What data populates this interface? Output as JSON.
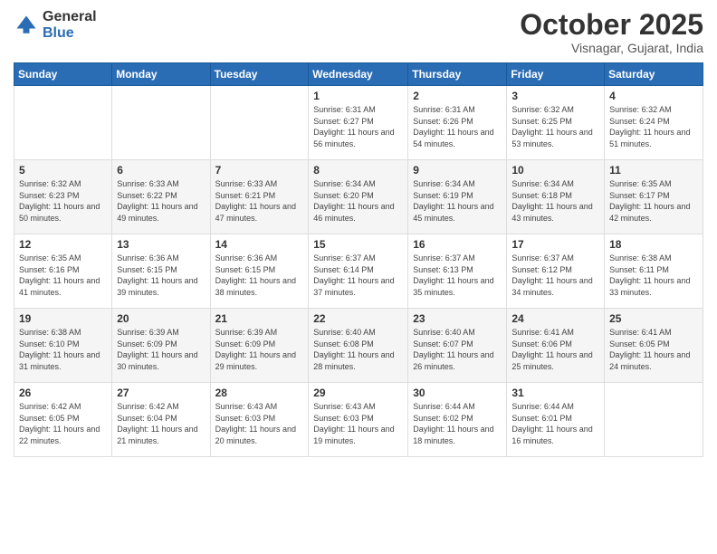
{
  "header": {
    "logo": {
      "general": "General",
      "blue": "Blue"
    },
    "title": "October 2025",
    "location": "Visnagar, Gujarat, India"
  },
  "weekdays": [
    "Sunday",
    "Monday",
    "Tuesday",
    "Wednesday",
    "Thursday",
    "Friday",
    "Saturday"
  ],
  "weeks": [
    [
      {
        "day": "",
        "sunrise": "",
        "sunset": "",
        "daylight": ""
      },
      {
        "day": "",
        "sunrise": "",
        "sunset": "",
        "daylight": ""
      },
      {
        "day": "",
        "sunrise": "",
        "sunset": "",
        "daylight": ""
      },
      {
        "day": "1",
        "sunrise": "Sunrise: 6:31 AM",
        "sunset": "Sunset: 6:27 PM",
        "daylight": "Daylight: 11 hours and 56 minutes."
      },
      {
        "day": "2",
        "sunrise": "Sunrise: 6:31 AM",
        "sunset": "Sunset: 6:26 PM",
        "daylight": "Daylight: 11 hours and 54 minutes."
      },
      {
        "day": "3",
        "sunrise": "Sunrise: 6:32 AM",
        "sunset": "Sunset: 6:25 PM",
        "daylight": "Daylight: 11 hours and 53 minutes."
      },
      {
        "day": "4",
        "sunrise": "Sunrise: 6:32 AM",
        "sunset": "Sunset: 6:24 PM",
        "daylight": "Daylight: 11 hours and 51 minutes."
      }
    ],
    [
      {
        "day": "5",
        "sunrise": "Sunrise: 6:32 AM",
        "sunset": "Sunset: 6:23 PM",
        "daylight": "Daylight: 11 hours and 50 minutes."
      },
      {
        "day": "6",
        "sunrise": "Sunrise: 6:33 AM",
        "sunset": "Sunset: 6:22 PM",
        "daylight": "Daylight: 11 hours and 49 minutes."
      },
      {
        "day": "7",
        "sunrise": "Sunrise: 6:33 AM",
        "sunset": "Sunset: 6:21 PM",
        "daylight": "Daylight: 11 hours and 47 minutes."
      },
      {
        "day": "8",
        "sunrise": "Sunrise: 6:34 AM",
        "sunset": "Sunset: 6:20 PM",
        "daylight": "Daylight: 11 hours and 46 minutes."
      },
      {
        "day": "9",
        "sunrise": "Sunrise: 6:34 AM",
        "sunset": "Sunset: 6:19 PM",
        "daylight": "Daylight: 11 hours and 45 minutes."
      },
      {
        "day": "10",
        "sunrise": "Sunrise: 6:34 AM",
        "sunset": "Sunset: 6:18 PM",
        "daylight": "Daylight: 11 hours and 43 minutes."
      },
      {
        "day": "11",
        "sunrise": "Sunrise: 6:35 AM",
        "sunset": "Sunset: 6:17 PM",
        "daylight": "Daylight: 11 hours and 42 minutes."
      }
    ],
    [
      {
        "day": "12",
        "sunrise": "Sunrise: 6:35 AM",
        "sunset": "Sunset: 6:16 PM",
        "daylight": "Daylight: 11 hours and 41 minutes."
      },
      {
        "day": "13",
        "sunrise": "Sunrise: 6:36 AM",
        "sunset": "Sunset: 6:15 PM",
        "daylight": "Daylight: 11 hours and 39 minutes."
      },
      {
        "day": "14",
        "sunrise": "Sunrise: 6:36 AM",
        "sunset": "Sunset: 6:15 PM",
        "daylight": "Daylight: 11 hours and 38 minutes."
      },
      {
        "day": "15",
        "sunrise": "Sunrise: 6:37 AM",
        "sunset": "Sunset: 6:14 PM",
        "daylight": "Daylight: 11 hours and 37 minutes."
      },
      {
        "day": "16",
        "sunrise": "Sunrise: 6:37 AM",
        "sunset": "Sunset: 6:13 PM",
        "daylight": "Daylight: 11 hours and 35 minutes."
      },
      {
        "day": "17",
        "sunrise": "Sunrise: 6:37 AM",
        "sunset": "Sunset: 6:12 PM",
        "daylight": "Daylight: 11 hours and 34 minutes."
      },
      {
        "day": "18",
        "sunrise": "Sunrise: 6:38 AM",
        "sunset": "Sunset: 6:11 PM",
        "daylight": "Daylight: 11 hours and 33 minutes."
      }
    ],
    [
      {
        "day": "19",
        "sunrise": "Sunrise: 6:38 AM",
        "sunset": "Sunset: 6:10 PM",
        "daylight": "Daylight: 11 hours and 31 minutes."
      },
      {
        "day": "20",
        "sunrise": "Sunrise: 6:39 AM",
        "sunset": "Sunset: 6:09 PM",
        "daylight": "Daylight: 11 hours and 30 minutes."
      },
      {
        "day": "21",
        "sunrise": "Sunrise: 6:39 AM",
        "sunset": "Sunset: 6:09 PM",
        "daylight": "Daylight: 11 hours and 29 minutes."
      },
      {
        "day": "22",
        "sunrise": "Sunrise: 6:40 AM",
        "sunset": "Sunset: 6:08 PM",
        "daylight": "Daylight: 11 hours and 28 minutes."
      },
      {
        "day": "23",
        "sunrise": "Sunrise: 6:40 AM",
        "sunset": "Sunset: 6:07 PM",
        "daylight": "Daylight: 11 hours and 26 minutes."
      },
      {
        "day": "24",
        "sunrise": "Sunrise: 6:41 AM",
        "sunset": "Sunset: 6:06 PM",
        "daylight": "Daylight: 11 hours and 25 minutes."
      },
      {
        "day": "25",
        "sunrise": "Sunrise: 6:41 AM",
        "sunset": "Sunset: 6:05 PM",
        "daylight": "Daylight: 11 hours and 24 minutes."
      }
    ],
    [
      {
        "day": "26",
        "sunrise": "Sunrise: 6:42 AM",
        "sunset": "Sunset: 6:05 PM",
        "daylight": "Daylight: 11 hours and 22 minutes."
      },
      {
        "day": "27",
        "sunrise": "Sunrise: 6:42 AM",
        "sunset": "Sunset: 6:04 PM",
        "daylight": "Daylight: 11 hours and 21 minutes."
      },
      {
        "day": "28",
        "sunrise": "Sunrise: 6:43 AM",
        "sunset": "Sunset: 6:03 PM",
        "daylight": "Daylight: 11 hours and 20 minutes."
      },
      {
        "day": "29",
        "sunrise": "Sunrise: 6:43 AM",
        "sunset": "Sunset: 6:03 PM",
        "daylight": "Daylight: 11 hours and 19 minutes."
      },
      {
        "day": "30",
        "sunrise": "Sunrise: 6:44 AM",
        "sunset": "Sunset: 6:02 PM",
        "daylight": "Daylight: 11 hours and 18 minutes."
      },
      {
        "day": "31",
        "sunrise": "Sunrise: 6:44 AM",
        "sunset": "Sunset: 6:01 PM",
        "daylight": "Daylight: 11 hours and 16 minutes."
      },
      {
        "day": "",
        "sunrise": "",
        "sunset": "",
        "daylight": ""
      }
    ]
  ]
}
